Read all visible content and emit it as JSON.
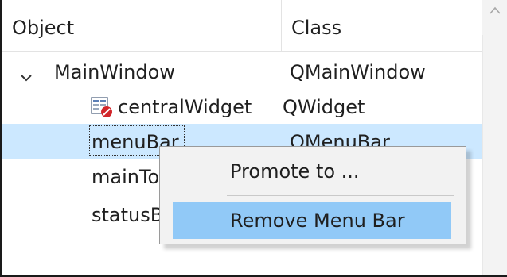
{
  "columns": {
    "object": "Object",
    "class": "Class"
  },
  "tree": {
    "root": {
      "object": "MainWindow",
      "class": "QMainWindow",
      "expanded": true
    },
    "children": [
      {
        "object": "centralWidget",
        "class": "QWidget",
        "icon": "widget-icon"
      },
      {
        "object": "menuBar",
        "class": "QMenuBar",
        "selected": true
      },
      {
        "object": "mainTo",
        "class": ""
      },
      {
        "object": "statusBa",
        "class": ""
      }
    ]
  },
  "context_menu": {
    "items": [
      {
        "label": "Promote to ..."
      },
      {
        "label": "Remove Menu Bar",
        "highlighted": true
      }
    ]
  },
  "colors": {
    "selection": "#cce8ff",
    "menu_highlight": "#91c9f7",
    "menu_background": "#f2f2f2"
  }
}
